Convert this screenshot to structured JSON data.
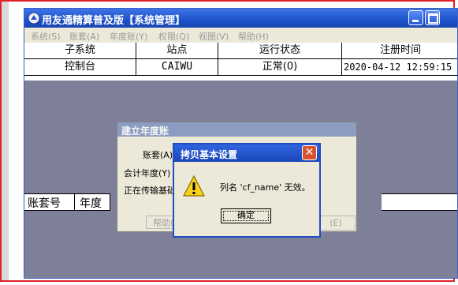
{
  "window": {
    "title": "用友通精算普及版【系统管理】",
    "menu": [
      "系统(S)",
      "账套(A)",
      "年度账(Y)",
      "权限(Q)",
      "视图(V)",
      "帮助(H)"
    ]
  },
  "subsystem_table": {
    "columns": [
      "子系统",
      "站点",
      "运行状态",
      "注册时间"
    ],
    "rows": [
      [
        "控制台",
        "CAIWU",
        "正常(0)",
        "2020-04-12 12:59:15"
      ]
    ]
  },
  "account_table": {
    "columns": [
      "账套号",
      "年度"
    ]
  },
  "create_year_dialog": {
    "title": "建立年度账",
    "labels": [
      "账套(A)",
      "会计年度(Y)",
      "正在传输基础"
    ],
    "buttons": [
      "帮助(",
      "(E)"
    ]
  },
  "error_dialog": {
    "title": "拷贝基本设置",
    "message": "列名 'cf_name' 无效。",
    "ok_label": "确定"
  }
}
